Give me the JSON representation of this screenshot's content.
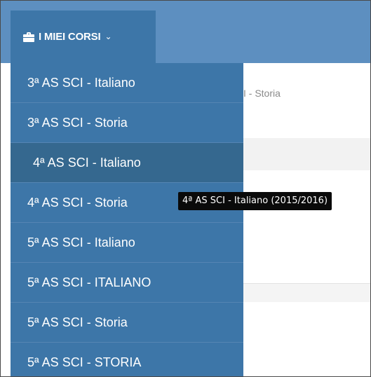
{
  "topbar": {
    "menu_label": "I MIEI CORSI",
    "menu_icon": "briefcase-icon",
    "chevron_icon": "chevron-down-icon",
    "chevron_glyph": "⌄"
  },
  "background": {
    "breadcrumb_partial": "I - Storia"
  },
  "dropdown": {
    "items": [
      {
        "label": "3ª AS SCI - Italiano"
      },
      {
        "label": "3ª AS SCI - Storia"
      },
      {
        "label": "4ª AS SCI - Italiano"
      },
      {
        "label": "4ª AS SCI - Storia"
      },
      {
        "label": "5ª AS SCI - Italiano"
      },
      {
        "label": "5ª AS SCI - ITALIANO"
      },
      {
        "label": "5ª AS SCI - Storia"
      },
      {
        "label": "5ª AS SCI - STORIA"
      }
    ],
    "hovered_index": 2
  },
  "tooltip": {
    "text": "4ª AS SCI - Italiano (2015/2016)"
  },
  "colors": {
    "topbar": "#5d8fc0",
    "menu": "#3d76a8",
    "menu_hover": "#35688f",
    "tooltip_bg": "#0a0a0a"
  }
}
